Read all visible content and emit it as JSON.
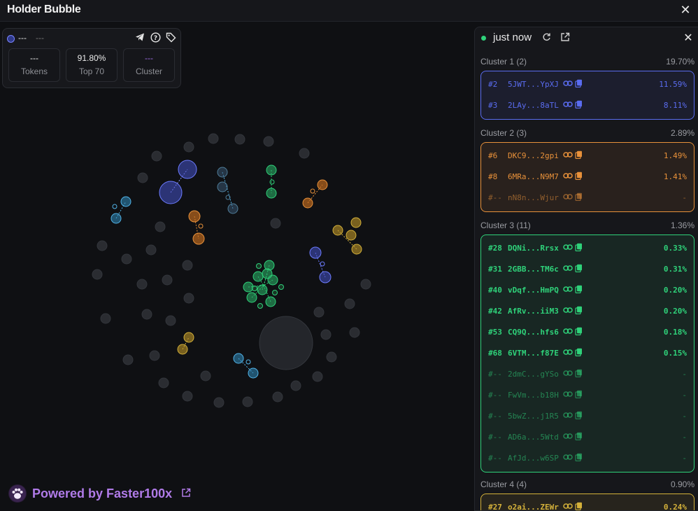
{
  "window": {
    "title": "Holder Bubble"
  },
  "stats": {
    "token_symbol": "---",
    "token_name": "---",
    "icons": [
      "telegram-icon",
      "help-icon",
      "tag-icon"
    ],
    "boxes": [
      {
        "value": "---",
        "label": "Tokens"
      },
      {
        "value": "91.80%",
        "label": "Top 70"
      },
      {
        "value": "---",
        "label": "Cluster"
      }
    ]
  },
  "footer": {
    "powered": "Powered by",
    "brand": "Faster100x"
  },
  "panel": {
    "updated": "just now",
    "clusters": [
      {
        "title": "Cluster 1 (2)",
        "pct": "19.70%",
        "color": "#5a6cf0",
        "rows": [
          {
            "rank": "#2",
            "addr": "5JWT...YpXJ",
            "pct": "11.59%",
            "bold": false
          },
          {
            "rank": "#3",
            "addr": "2LAy...8aTL",
            "pct": "8.11%",
            "bold": false
          }
        ]
      },
      {
        "title": "Cluster 2 (3)",
        "pct": "2.89%",
        "color": "#e8913a",
        "rows": [
          {
            "rank": "#6",
            "addr": "DKC9...2gpi",
            "pct": "1.49%",
            "bold": false
          },
          {
            "rank": "#8",
            "addr": "6MRa...N9M7",
            "pct": "1.41%",
            "bold": false
          },
          {
            "rank": "#--",
            "addr": "nN8n...Wjur",
            "pct": "-",
            "bold": false,
            "dim": true
          }
        ]
      },
      {
        "title": "Cluster 3 (11)",
        "pct": "1.36%",
        "color": "#2fd27a",
        "rows": [
          {
            "rank": "#28",
            "addr": "DQNi...Rrsx",
            "pct": "0.33%",
            "bold": true
          },
          {
            "rank": "#31",
            "addr": "2GBB...TM6c",
            "pct": "0.31%",
            "bold": true
          },
          {
            "rank": "#40",
            "addr": "vDqf...HmPQ",
            "pct": "0.20%",
            "bold": true
          },
          {
            "rank": "#42",
            "addr": "AfRv...iiM3",
            "pct": "0.20%",
            "bold": true
          },
          {
            "rank": "#53",
            "addr": "CQ9Q...hfs6",
            "pct": "0.18%",
            "bold": true
          },
          {
            "rank": "#68",
            "addr": "6VTM...f87E",
            "pct": "0.15%",
            "bold": true
          },
          {
            "rank": "#--",
            "addr": "2dmC...gYSo",
            "pct": "-",
            "bold": false,
            "dim": true
          },
          {
            "rank": "#--",
            "addr": "FwVm...b18H",
            "pct": "-",
            "bold": false,
            "dim": true
          },
          {
            "rank": "#--",
            "addr": "5bwZ...j1R5",
            "pct": "-",
            "bold": false,
            "dim": true
          },
          {
            "rank": "#--",
            "addr": "AD6a...5Wtd",
            "pct": "-",
            "bold": false,
            "dim": true
          },
          {
            "rank": "#--",
            "addr": "AfJd...w6SP",
            "pct": "-",
            "bold": false,
            "dim": true
          }
        ]
      },
      {
        "title": "Cluster 4 (4)",
        "pct": "0.90%",
        "color": "#d4b13a",
        "rows": [
          {
            "rank": "#27",
            "addr": "o2ai...ZEWr",
            "pct": "0.24%",
            "bold": true
          }
        ]
      }
    ]
  }
}
